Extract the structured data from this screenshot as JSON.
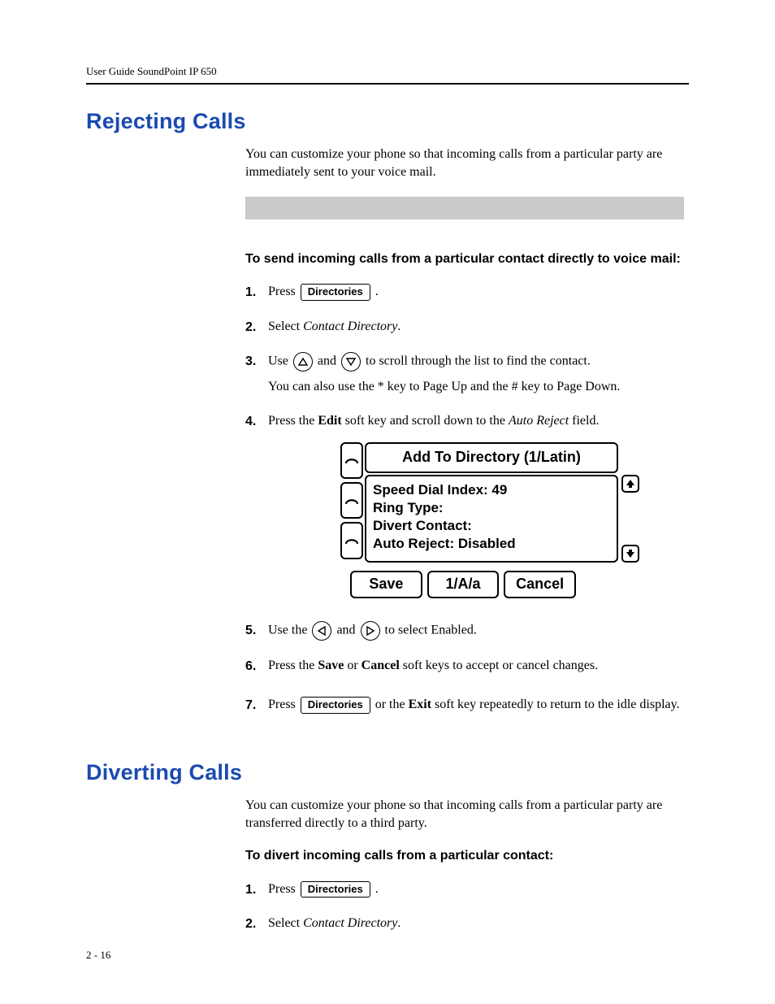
{
  "running_head": "User Guide SoundPoint IP 650",
  "page_number": "2 - 16",
  "sections": {
    "reject": {
      "title": "Rejecting Calls",
      "intro": "You can customize your phone so that incoming calls from a particular party are immediately sent to your voice mail.",
      "lead": "To send incoming calls from a particular contact directly to voice mail:",
      "steps": {
        "s1": {
          "before": "Press ",
          "key": "Directories",
          "after": " ."
        },
        "s2": {
          "before": "Select ",
          "ital": "Contact Directory",
          "after": "."
        },
        "s3": {
          "before": "Use ",
          "mid": " and ",
          "after": " to scroll through the list to find the contact.",
          "sub": "You can also use the * key to Page Up and the # key to Page Down."
        },
        "s4": {
          "a": "Press the ",
          "b": "Edit",
          "c": " soft key and scroll down to the ",
          "d": "Auto Reject",
          "e": " field."
        },
        "s5": {
          "before": "Use the ",
          "mid": " and ",
          "after": " to select Enabled."
        },
        "s6": {
          "a": "Press the ",
          "b": "Save",
          "c": " or ",
          "d": "Cancel",
          "e": " soft keys to accept or cancel changes."
        },
        "s7": {
          "a": "Press ",
          "key": "Directories",
          "b": " or the ",
          "c": "Exit",
          "d": " soft key repeatedly to return to the idle display."
        }
      },
      "screen": {
        "title": "Add To Directory (1/Latin)",
        "lines": {
          "l1": "Speed Dial Index: 49",
          "l2": "Ring Type:",
          "l3": "Divert Contact:",
          "l4": "Auto Reject: Disabled"
        },
        "softkeys": {
          "k1": "Save",
          "k2": "1/A/a",
          "k3": "Cancel"
        }
      }
    },
    "divert": {
      "title": "Diverting Calls",
      "intro": "You can customize your phone so that incoming calls from a particular party are transferred directly to a third party.",
      "lead": "To divert incoming calls from a particular contact:",
      "steps": {
        "s1": {
          "before": "Press ",
          "key": "Directories",
          "after": " ."
        },
        "s2": {
          "before": "Select ",
          "ital": "Contact Directory",
          "after": "."
        }
      }
    }
  },
  "nums": {
    "n1": "1.",
    "n2": "2.",
    "n3": "3.",
    "n4": "4.",
    "n5": "5.",
    "n6": "6.",
    "n7": "7."
  }
}
